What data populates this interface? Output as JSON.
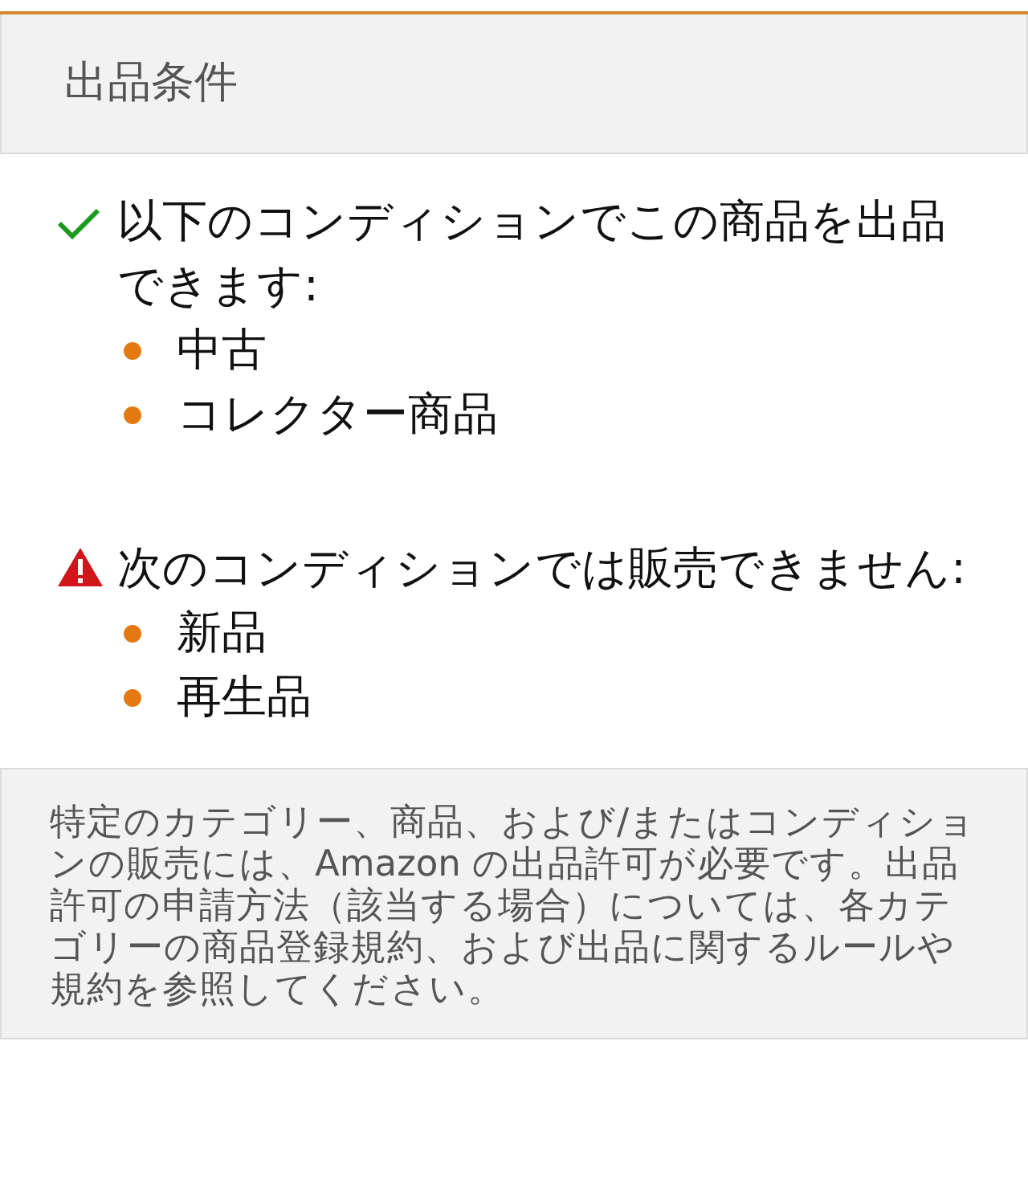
{
  "header": {
    "title": "出品条件"
  },
  "sections": [
    {
      "kind": "allowed",
      "heading": "以下のコンディションでこの商品を出品できます:",
      "items": [
        "中古",
        "コレクター商品"
      ]
    },
    {
      "kind": "blocked",
      "heading": "次のコンディションでは販売できません:",
      "items": [
        "新品",
        "再生品"
      ]
    }
  ],
  "note": "特定のカテゴリー、商品、および/またはコンディションの販売には、Amazon の出品許可が必要です。出品許可の申請方法（該当する場合）については、各カテゴリーの商品登録規約、および出品に関するルールや規約を参照してください。"
}
